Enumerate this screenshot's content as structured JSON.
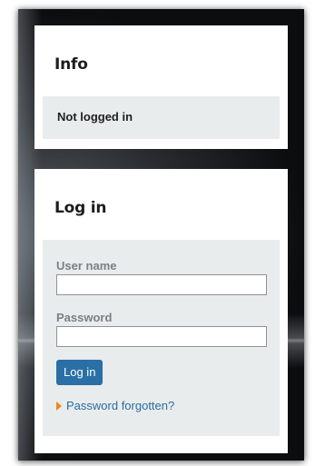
{
  "info": {
    "title": "Info",
    "status": "Not logged in"
  },
  "login": {
    "title": "Log in",
    "username_label": "User name",
    "username_value": "",
    "password_label": "Password",
    "password_value": "",
    "submit_label": "Log in",
    "forgot_label": "Password forgotten?"
  },
  "colors": {
    "button": "#2a6fa6",
    "link": "#2c6ca0",
    "arrow": "#f2851f",
    "panel": "#e9ecec"
  },
  "icons": {
    "forgot_arrow": "arrow-right-icon"
  }
}
